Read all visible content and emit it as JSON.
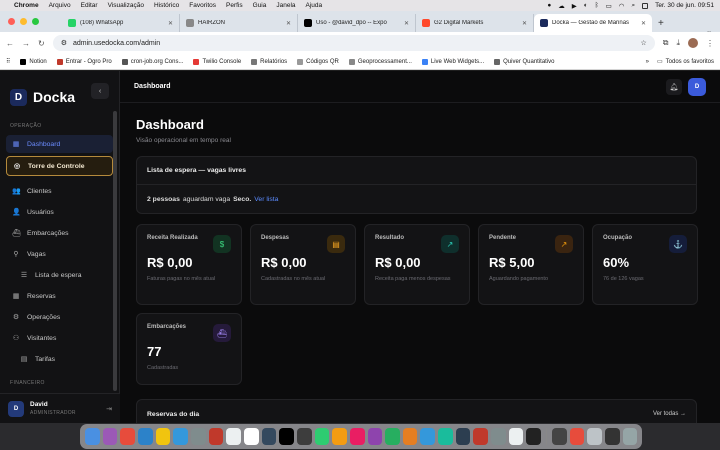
{
  "menubar": {
    "app": "Chrome",
    "items": [
      "Arquivo",
      "Editar",
      "Visualização",
      "Histórico",
      "Favoritos",
      "Perfis",
      "Guia",
      "Janela",
      "Ajuda"
    ],
    "clock": "Ter. 30 de jun.  09:51"
  },
  "tabs": [
    {
      "title": "(108) WhatsApp",
      "color": "#25d366"
    },
    {
      "title": "HAIRZON",
      "color": "#888888"
    },
    {
      "title": "Uso - @david_dpo -- Expo",
      "color": "#000000"
    },
    {
      "title": "G2 Digital Markets",
      "color": "#ff492c"
    },
    {
      "title": "Docka — Gestão de Marinas",
      "color": "#1b2a5c"
    }
  ],
  "address": {
    "url": "admin.usedocka.com/admin"
  },
  "bookmarks": [
    {
      "label": "Notion",
      "color": "#000000"
    },
    {
      "label": "Entrar - Ogro Pro",
      "color": "#c0392b"
    },
    {
      "label": "cron-job.org Cons...",
      "color": "#555555"
    },
    {
      "label": "Twilio Console",
      "color": "#e53935"
    },
    {
      "label": "Relatórios",
      "color": "#777777"
    },
    {
      "label": "Códigos QR",
      "color": "#999999"
    },
    {
      "label": "Geoprocessament...",
      "color": "#888888"
    },
    {
      "label": "Live Web Widgets...",
      "color": "#3b82f6"
    },
    {
      "label": "Quiver Quantitativo",
      "color": "#666666"
    }
  ],
  "bookmarks_right": "Todos os favoritos",
  "sidebar": {
    "brand": "Docka",
    "section_ops": "OPERAÇÃO",
    "section_fin": "FINANCEIRO",
    "items": [
      {
        "label": "Dashboard",
        "icon": "grid-icon",
        "glyph": "▦"
      },
      {
        "label": "Torre de Controle",
        "icon": "radar-icon",
        "glyph": "◎"
      },
      {
        "label": "Clientes",
        "icon": "users-icon",
        "glyph": "👥"
      },
      {
        "label": "Usuários",
        "icon": "user-icon",
        "glyph": "👤"
      },
      {
        "label": "Embarcações",
        "icon": "boat-icon",
        "glyph": "⛴"
      },
      {
        "label": "Vagas",
        "icon": "pin-icon",
        "glyph": "⚲"
      },
      {
        "label": "Lista de espera",
        "icon": "list-icon",
        "glyph": "☰"
      },
      {
        "label": "Reservas",
        "icon": "calendar-icon",
        "glyph": "▦"
      },
      {
        "label": "Operações",
        "icon": "wrench-icon",
        "glyph": "⚙"
      },
      {
        "label": "Visitantes",
        "icon": "visitor-icon",
        "glyph": "⚇"
      },
      {
        "label": "Tarifas",
        "icon": "tag-icon",
        "glyph": "▤"
      }
    ],
    "user": {
      "initial": "D",
      "name": "David",
      "role": "ADMINISTRADOR"
    }
  },
  "topbar": {
    "breadcrumb": "Dashboard",
    "user_initial": "D"
  },
  "page": {
    "title": "Dashboard",
    "subtitle": "Visão operacional em tempo real"
  },
  "waitlist": {
    "title": "Lista de espera — vagas livres",
    "count_text": "2 pessoas",
    "mid_text": "aguardam vaga",
    "place": "Seco.",
    "link": "Ver lista"
  },
  "cards": [
    {
      "label": "Receita Realizada",
      "value": "R$ 0,00",
      "hint": "Faturas pagas no mês atual",
      "icon": "dollar-icon",
      "glyph": "$",
      "bg": "#123322",
      "fg": "#3ddc84"
    },
    {
      "label": "Despesas",
      "value": "R$ 0,00",
      "hint": "Cadastradas no mês atual",
      "icon": "receipt-icon",
      "glyph": "▤",
      "bg": "#3a2a0e",
      "fg": "#f5a623"
    },
    {
      "label": "Resultado",
      "value": "R$ 0,00",
      "hint": "Receita paga menos despesas",
      "icon": "trend-up-icon",
      "glyph": "↗",
      "bg": "#0f2f2c",
      "fg": "#2dd4bf"
    },
    {
      "label": "Pendente",
      "value": "R$ 5,00",
      "hint": "Aguardando pagamento",
      "icon": "trend-icon",
      "glyph": "↗",
      "bg": "#3a2410",
      "fg": "#f59e0b"
    },
    {
      "label": "Ocupação",
      "value": "60%",
      "hint": "76 de 126 vagas",
      "icon": "anchor-icon",
      "glyph": "⚓",
      "bg": "#151d3a",
      "fg": "#6b8cff"
    },
    {
      "label": "Embarcações",
      "value": "77",
      "hint": "Cadastradas",
      "icon": "ship-icon",
      "glyph": "⛴",
      "bg": "#251a3a",
      "fg": "#a78bfa"
    }
  ],
  "reservas": {
    "title": "Reservas do dia",
    "link": "Ver todas →"
  },
  "dock_colors": [
    "#4a90e2",
    "#9b59b6",
    "#e74c3c",
    "#2c82c9",
    "#f1c40f",
    "#3498db",
    "#7f8c8d",
    "#c0392b",
    "#ecf0f1",
    "#ffffff",
    "#34495e",
    "#000000",
    "#3d3d3d",
    "#2ecc71",
    "#f39c12",
    "#e91e63",
    "#8e44ad",
    "#27ae60",
    "#e67e22",
    "#3498db",
    "#1abc9c",
    "#2c3e50",
    "#c0392b",
    "#7f8c8d",
    "#ecf0f1",
    "#222222",
    "#444444",
    "#e74c3c",
    "#bdc3c7",
    "#333333",
    "#95a5a6"
  ]
}
